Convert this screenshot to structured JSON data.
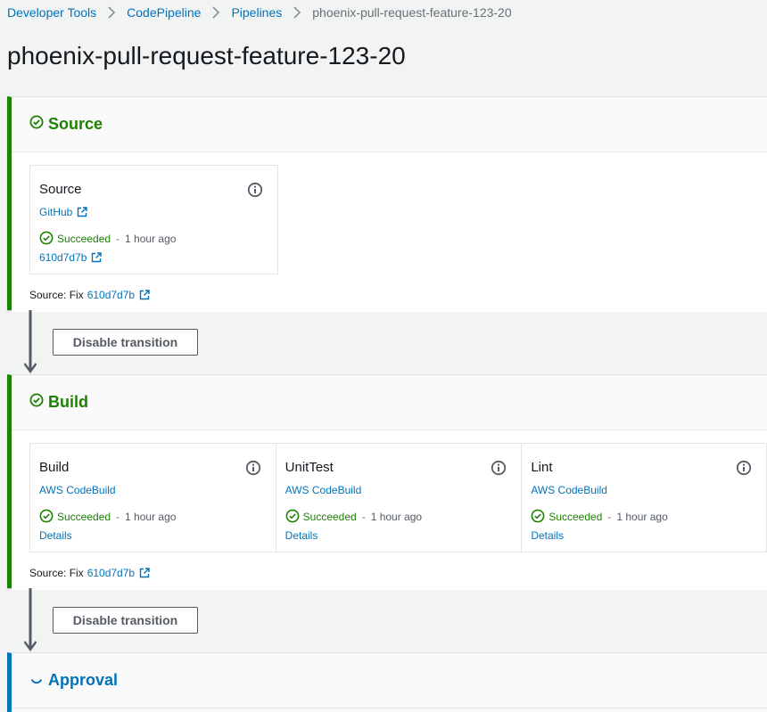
{
  "breadcrumb": [
    "Developer Tools",
    "CodePipeline",
    "Pipelines",
    "phoenix-pull-request-feature-123-20"
  ],
  "page_title": "phoenix-pull-request-feature-123-20",
  "colors": {
    "success": "#1d8102",
    "link": "#0073bb",
    "in_progress": "#0073bb"
  },
  "transition_button_label": "Disable transition",
  "stages": {
    "source": {
      "title": "Source",
      "status_icon": "check-circle-icon",
      "actions": [
        {
          "name": "Source",
          "provider": "GitHub",
          "status": "Succeeded",
          "dash": "-",
          "time": "1 hour ago",
          "sublink": "610d7d7b"
        }
      ],
      "footer_label": "Source: Fix",
      "footer_commit": "610d7d7b"
    },
    "build": {
      "title": "Build",
      "status_icon": "check-circle-icon",
      "actions": [
        {
          "name": "Build",
          "provider": "AWS CodeBuild",
          "status": "Succeeded",
          "dash": "-",
          "time": "1 hour ago",
          "sublink": "Details"
        },
        {
          "name": "UnitTest",
          "provider": "AWS CodeBuild",
          "status": "Succeeded",
          "dash": "-",
          "time": "1 hour ago",
          "sublink": "Details"
        },
        {
          "name": "Lint",
          "provider": "AWS CodeBuild",
          "status": "Succeeded",
          "dash": "-",
          "time": "1 hour ago",
          "sublink": "Details"
        }
      ],
      "footer_label": "Source: Fix",
      "footer_commit": "610d7d7b"
    },
    "approval": {
      "title": "Approval",
      "status_icon": "in-progress-spinner-icon"
    }
  }
}
